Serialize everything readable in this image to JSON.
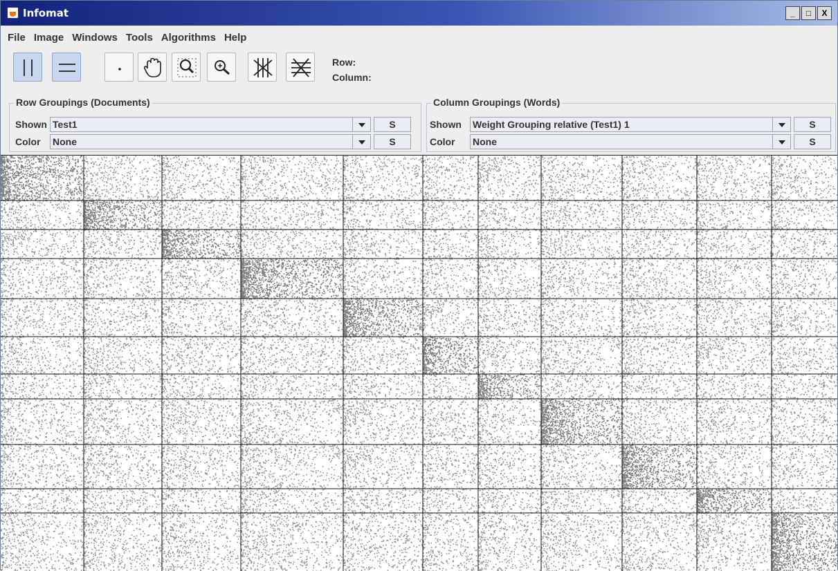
{
  "window": {
    "title": "Infomat"
  },
  "window_controls": {
    "minimize": "_",
    "maximize": "□",
    "close": "X"
  },
  "menu": {
    "items": [
      "File",
      "Image",
      "Windows",
      "Tools",
      "Algorithms",
      "Help"
    ]
  },
  "toolbar": {
    "tools": [
      {
        "name": "column-select-tool",
        "icon": "vertical-lines-icon",
        "selected": true
      },
      {
        "name": "row-select-tool",
        "icon": "horizontal-lines-icon",
        "selected": true
      },
      {
        "name": "point-tool",
        "icon": "dot-icon",
        "selected": false
      },
      {
        "name": "pan-tool",
        "icon": "hand-icon",
        "selected": false
      },
      {
        "name": "zoom-area-tool",
        "icon": "zoom-rect-icon",
        "selected": false
      },
      {
        "name": "zoom-in-tool",
        "icon": "zoom-in-icon",
        "selected": false
      },
      {
        "name": "cut-columns-tool",
        "icon": "cut-columns-icon",
        "selected": false
      },
      {
        "name": "cut-rows-tool",
        "icon": "cut-rows-icon",
        "selected": false
      }
    ],
    "row_label": "Row:",
    "column_label": "Column:"
  },
  "row_groupings": {
    "title": "Row Groupings (Documents)",
    "shown_label": "Shown",
    "shown_value": "Test1",
    "color_label": "Color",
    "color_value": "None",
    "s_label": "S"
  },
  "column_groupings": {
    "title": "Column Groupings (Words)",
    "shown_label": "Shown",
    "shown_value": "Weight Grouping relative (Test1) 1",
    "color_label": "Color",
    "color_value": "None",
    "s_label": "S"
  },
  "colors": {
    "title_start": "#13227a",
    "title_end": "#a9bde6",
    "dot": "#6e6e6e",
    "grid_line": "#111111",
    "selected_tool": "#c7d7f0"
  },
  "matrix": {
    "row_groups": 11,
    "column_groups": 11
  }
}
